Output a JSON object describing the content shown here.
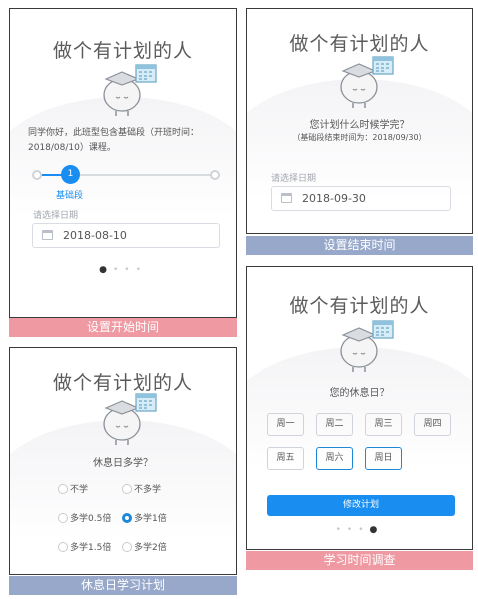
{
  "common": {
    "title": "做个有计划的人",
    "calendar_badge": "日历"
  },
  "panel1": {
    "intro": "同学你好，此班型包含基础段（开班时间：",
    "intro2": "2018/08/10）课程。",
    "step_number": "1",
    "step_label": "基础段",
    "date_label": "请选择日期",
    "date_value": "2018-08-10",
    "dots": [
      "●",
      "●",
      "●",
      "●"
    ],
    "caption": "设置开始时间"
  },
  "panel2": {
    "question": "您计划什么时候学完？",
    "note": "（基础段结束时间为：2018/09/30）",
    "date_label": "请选择日期",
    "date_value": "2018-09-30",
    "caption": "设置结束时间"
  },
  "panel3": {
    "question": "休息日多学？",
    "options": [
      "不学",
      "不多学",
      "多学0.5倍",
      "多学1倍",
      "多学1.5倍",
      "多学2倍"
    ],
    "selected_option": "多学1倍",
    "caption": "休息日学习计划"
  },
  "panel4": {
    "question": "您的休息日？",
    "days": [
      "周一",
      "周二",
      "周三",
      "周四",
      "周五",
      "周六",
      "周日"
    ],
    "selected_days": [
      "周六",
      "周日"
    ],
    "button": "修改计划",
    "caption": "学习时间调查"
  },
  "colors": {
    "accent": "#1a8ef0",
    "caption_pink": "#ef9aa3",
    "caption_blue": "#97a8cb"
  }
}
